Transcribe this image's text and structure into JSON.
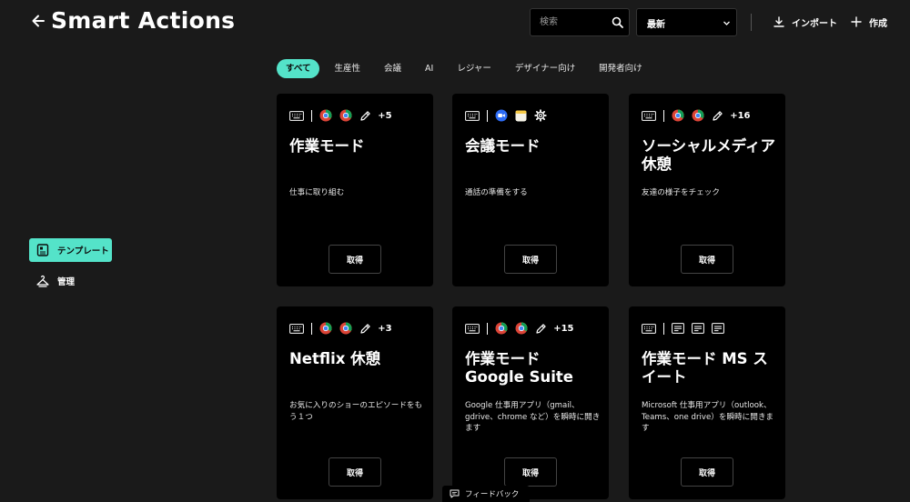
{
  "header": {
    "title": "Smart Actions",
    "search_placeholder": "検索",
    "sort_value": "最新",
    "import_label": "インポート",
    "create_label": "作成"
  },
  "filters": [
    "すべて",
    "生産性",
    "会議",
    "AI",
    "レジャー",
    "デザイナー向け",
    "開発者向け"
  ],
  "active_filter": "すべて",
  "sidebar": {
    "items": [
      {
        "label": "テンプレート",
        "icon": "template-icon",
        "active": true
      },
      {
        "label": "管理",
        "icon": "hanger-icon",
        "active": false
      }
    ]
  },
  "cards": [
    {
      "title": "作業モード",
      "description": "仕事に取り組む",
      "icons": [
        "keyboard-icon",
        "chrome-icon",
        "chrome-icon",
        "pencil-icon"
      ],
      "more": "+5",
      "button": "取得"
    },
    {
      "title": "会議モード",
      "description": "通話の準備をする",
      "icons": [
        "keyboard-icon",
        "zoom-icon",
        "notes-icon",
        "gear-icon"
      ],
      "more": "",
      "button": "取得"
    },
    {
      "title": "ソーシャルメディア休憩",
      "description": "友達の様子をチェック",
      "icons": [
        "keyboard-icon",
        "chrome-icon",
        "chrome-icon",
        "pencil-icon"
      ],
      "more": "+16",
      "button": "取得"
    },
    {
      "title": "Netflix 休憩",
      "description": "お気に入りのショーのエピソードをもう１つ",
      "icons": [
        "keyboard-icon",
        "chrome-icon",
        "chrome-icon",
        "pencil-icon"
      ],
      "more": "+3",
      "button": "取得"
    },
    {
      "title": "作業モード Google Suite",
      "description": "Google 仕事用アプリ（gmail、gdrive、chrome など）を瞬時に開きます",
      "icons": [
        "keyboard-icon",
        "chrome-icon",
        "chrome-icon",
        "pencil-icon"
      ],
      "more": "+15",
      "button": "取得"
    },
    {
      "title": "作業モード MS スイート",
      "description": "Microsoft 仕事用アプリ（outlook、Teams、one drive）を瞬時に開きます",
      "icons": [
        "keyboard-icon",
        "app-window-icon",
        "app-window-icon",
        "app-window-icon"
      ],
      "more": "",
      "button": "取得"
    }
  ],
  "feedback_label": "フィードバック",
  "colors": {
    "accent": "#54e3c9",
    "background": "#1a1a1a",
    "card": "#000000"
  }
}
